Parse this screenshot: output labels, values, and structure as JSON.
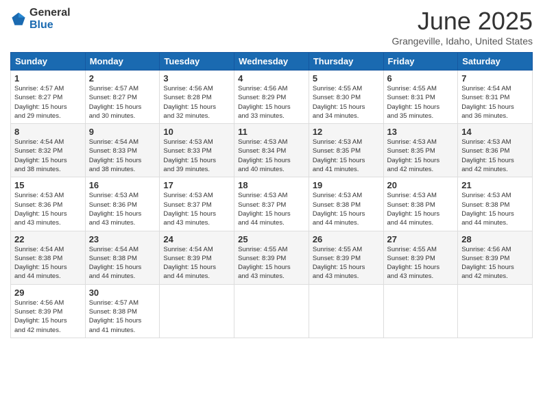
{
  "logo": {
    "text_general": "General",
    "text_blue": "Blue"
  },
  "title": "June 2025",
  "subtitle": "Grangeville, Idaho, United States",
  "headers": [
    "Sunday",
    "Monday",
    "Tuesday",
    "Wednesday",
    "Thursday",
    "Friday",
    "Saturday"
  ],
  "weeks": [
    [
      {
        "day": "1",
        "sunrise": "4:57 AM",
        "sunset": "8:27 PM",
        "daylight": "15 hours and 29 minutes."
      },
      {
        "day": "2",
        "sunrise": "4:57 AM",
        "sunset": "8:27 PM",
        "daylight": "15 hours and 30 minutes."
      },
      {
        "day": "3",
        "sunrise": "4:56 AM",
        "sunset": "8:28 PM",
        "daylight": "15 hours and 32 minutes."
      },
      {
        "day": "4",
        "sunrise": "4:56 AM",
        "sunset": "8:29 PM",
        "daylight": "15 hours and 33 minutes."
      },
      {
        "day": "5",
        "sunrise": "4:55 AM",
        "sunset": "8:30 PM",
        "daylight": "15 hours and 34 minutes."
      },
      {
        "day": "6",
        "sunrise": "4:55 AM",
        "sunset": "8:31 PM",
        "daylight": "15 hours and 35 minutes."
      },
      {
        "day": "7",
        "sunrise": "4:54 AM",
        "sunset": "8:31 PM",
        "daylight": "15 hours and 36 minutes."
      }
    ],
    [
      {
        "day": "8",
        "sunrise": "4:54 AM",
        "sunset": "8:32 PM",
        "daylight": "15 hours and 38 minutes."
      },
      {
        "day": "9",
        "sunrise": "4:54 AM",
        "sunset": "8:33 PM",
        "daylight": "15 hours and 38 minutes."
      },
      {
        "day": "10",
        "sunrise": "4:53 AM",
        "sunset": "8:33 PM",
        "daylight": "15 hours and 39 minutes."
      },
      {
        "day": "11",
        "sunrise": "4:53 AM",
        "sunset": "8:34 PM",
        "daylight": "15 hours and 40 minutes."
      },
      {
        "day": "12",
        "sunrise": "4:53 AM",
        "sunset": "8:35 PM",
        "daylight": "15 hours and 41 minutes."
      },
      {
        "day": "13",
        "sunrise": "4:53 AM",
        "sunset": "8:35 PM",
        "daylight": "15 hours and 42 minutes."
      },
      {
        "day": "14",
        "sunrise": "4:53 AM",
        "sunset": "8:36 PM",
        "daylight": "15 hours and 42 minutes."
      }
    ],
    [
      {
        "day": "15",
        "sunrise": "4:53 AM",
        "sunset": "8:36 PM",
        "daylight": "15 hours and 43 minutes."
      },
      {
        "day": "16",
        "sunrise": "4:53 AM",
        "sunset": "8:36 PM",
        "daylight": "15 hours and 43 minutes."
      },
      {
        "day": "17",
        "sunrise": "4:53 AM",
        "sunset": "8:37 PM",
        "daylight": "15 hours and 43 minutes."
      },
      {
        "day": "18",
        "sunrise": "4:53 AM",
        "sunset": "8:37 PM",
        "daylight": "15 hours and 44 minutes."
      },
      {
        "day": "19",
        "sunrise": "4:53 AM",
        "sunset": "8:38 PM",
        "daylight": "15 hours and 44 minutes."
      },
      {
        "day": "20",
        "sunrise": "4:53 AM",
        "sunset": "8:38 PM",
        "daylight": "15 hours and 44 minutes."
      },
      {
        "day": "21",
        "sunrise": "4:53 AM",
        "sunset": "8:38 PM",
        "daylight": "15 hours and 44 minutes."
      }
    ],
    [
      {
        "day": "22",
        "sunrise": "4:54 AM",
        "sunset": "8:38 PM",
        "daylight": "15 hours and 44 minutes."
      },
      {
        "day": "23",
        "sunrise": "4:54 AM",
        "sunset": "8:38 PM",
        "daylight": "15 hours and 44 minutes."
      },
      {
        "day": "24",
        "sunrise": "4:54 AM",
        "sunset": "8:39 PM",
        "daylight": "15 hours and 44 minutes."
      },
      {
        "day": "25",
        "sunrise": "4:55 AM",
        "sunset": "8:39 PM",
        "daylight": "15 hours and 43 minutes."
      },
      {
        "day": "26",
        "sunrise": "4:55 AM",
        "sunset": "8:39 PM",
        "daylight": "15 hours and 43 minutes."
      },
      {
        "day": "27",
        "sunrise": "4:55 AM",
        "sunset": "8:39 PM",
        "daylight": "15 hours and 43 minutes."
      },
      {
        "day": "28",
        "sunrise": "4:56 AM",
        "sunset": "8:39 PM",
        "daylight": "15 hours and 42 minutes."
      }
    ],
    [
      {
        "day": "29",
        "sunrise": "4:56 AM",
        "sunset": "8:39 PM",
        "daylight": "15 hours and 42 minutes."
      },
      {
        "day": "30",
        "sunrise": "4:57 AM",
        "sunset": "8:38 PM",
        "daylight": "15 hours and 41 minutes."
      },
      null,
      null,
      null,
      null,
      null
    ]
  ]
}
